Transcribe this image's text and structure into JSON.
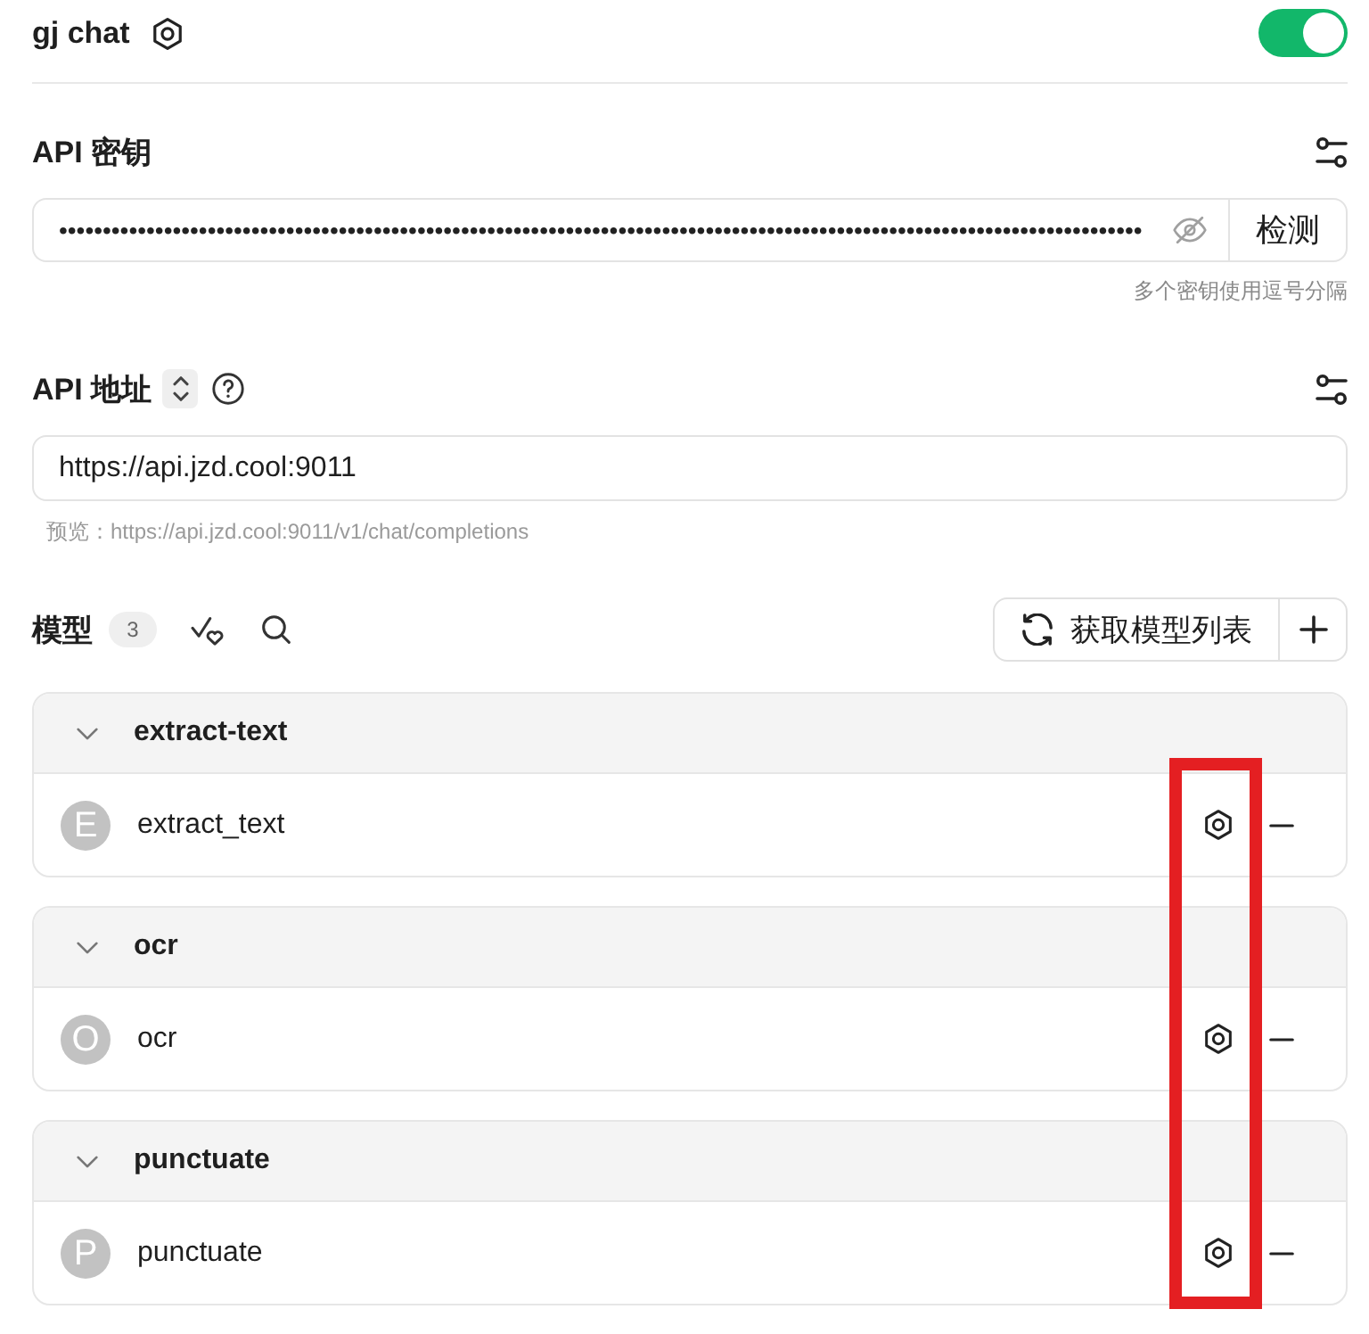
{
  "provider": {
    "name": "gj chat",
    "enabled": true
  },
  "api_key": {
    "label": "API 密钥",
    "value": "••••••••••••••••••••••••••••••••••••••••••••••••••••••••••••••••••••••••••••••••••••••••••••••••••••••••••••••••••••••••••••",
    "button": "检测",
    "hint": "多个密钥使用逗号分隔"
  },
  "api_url": {
    "label": "API 地址",
    "value": "https://api.jzd.cool:9011",
    "preview": "预览：https://api.jzd.cool:9011/v1/chat/completions"
  },
  "models": {
    "label": "模型",
    "count": "3",
    "fetch_button": "获取模型列表",
    "groups": [
      {
        "title": "extract-text",
        "expanded": true,
        "items": [
          {
            "avatar": "E",
            "name": "extract_text",
            "highlighted": true
          }
        ]
      },
      {
        "title": "ocr",
        "expanded": true,
        "items": [
          {
            "avatar": "O",
            "name": "ocr",
            "highlighted": true
          }
        ]
      },
      {
        "title": "punctuate",
        "expanded": true,
        "items": [
          {
            "avatar": "P",
            "name": "punctuate",
            "highlighted": true
          }
        ]
      }
    ]
  }
}
